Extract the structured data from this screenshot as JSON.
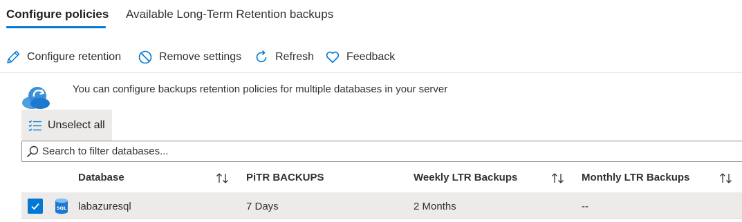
{
  "tabs": [
    {
      "label": "Configure policies",
      "active": true
    },
    {
      "label": "Available Long-Term Retention backups",
      "active": false
    }
  ],
  "toolbar": {
    "configure_retention": "Configure retention",
    "remove_settings": "Remove settings",
    "refresh": "Refresh",
    "feedback": "Feedback"
  },
  "info": {
    "text": "You can configure backups retention policies for multiple databases in your server"
  },
  "unselect_all": "Unselect all",
  "search": {
    "placeholder": "Search to filter databases...",
    "value": ""
  },
  "table": {
    "columns": [
      "Database",
      "PiTR BACKUPS",
      "Weekly LTR Backups",
      "Monthly LTR Backups"
    ],
    "rows": [
      {
        "selected": true,
        "database": "labazuresql",
        "pitr": "7 Days",
        "weekly": "2 Months",
        "monthly": "--",
        "db_icon_text": "SQL"
      }
    ]
  },
  "icons": {
    "configure": "pencil-icon",
    "remove": "prohibited-icon",
    "refresh": "refresh-icon",
    "feedback": "heart-icon",
    "unselect": "checklist-icon",
    "search": "search-icon",
    "sort": "sort-arrows-icon",
    "info": "cloud-backup-icon",
    "database": "sql-database-icon"
  },
  "colors": {
    "accent": "#0078d4",
    "selected_row": "#edebe9",
    "text": "#323130"
  }
}
